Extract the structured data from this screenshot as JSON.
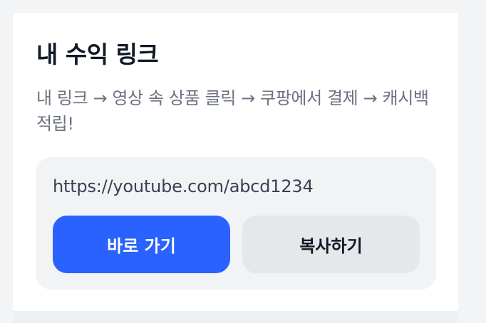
{
  "card": {
    "title": "내 수익 링크",
    "description": "내 링크 → 영상 속 상품 클릭 → 쿠팡에서 결제 → 캐시백 적립!",
    "link_url": "https://youtube.com/abcd1234",
    "go_button_label": "바로 가기",
    "copy_button_label": "복사하기"
  },
  "colors": {
    "accent": "#2962ff",
    "background": "#f3f4f6",
    "card": "#ffffff",
    "link_box": "#f2f3f5",
    "secondary_button": "#e5e7eb"
  }
}
